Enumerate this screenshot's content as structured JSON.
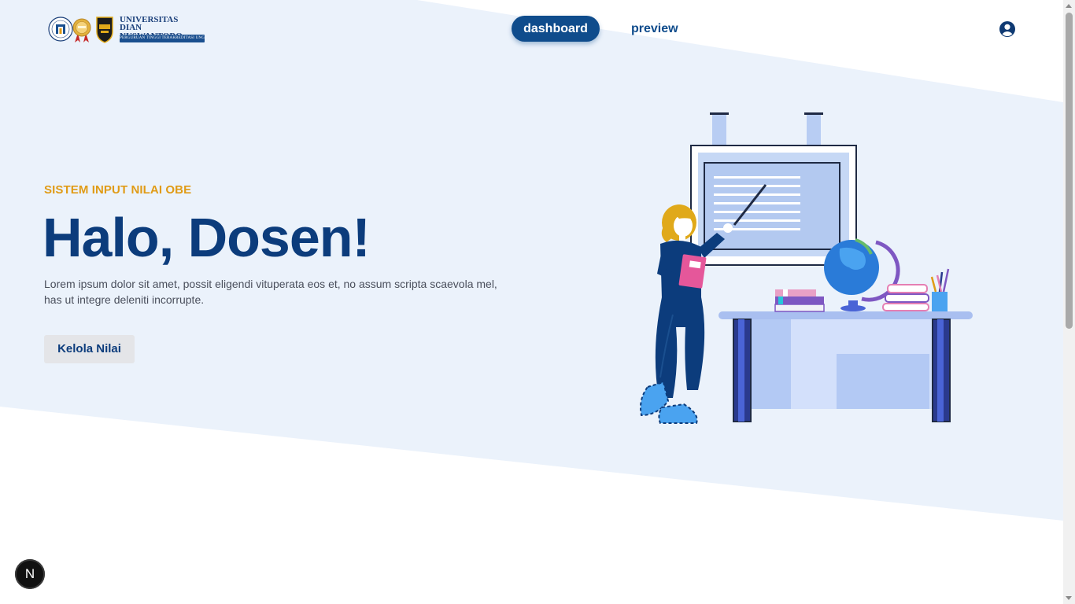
{
  "header": {
    "logo": {
      "university_line1": "UNIVERSITAS",
      "university_line2": "DIAN NUSWANTORO",
      "tagline": "PERGURUAN TINGGI TERAKREDITASI UNGGUL"
    },
    "nav": {
      "dashboard_label": "dashboard",
      "preview_label": "preview",
      "active": "dashboard"
    },
    "user_icon": "user-circle-icon"
  },
  "hero": {
    "eyebrow": "SISTEM INPUT NILAI OBE",
    "title": "Halo, Dosen!",
    "description": "Lorem ipsum dolor sit amet, possit eligendi vituperata eos et, no assum scripta scaevola mel, has ut integre deleniti incorrupte.",
    "cta_label": "Kelola Nilai"
  },
  "floating_badge": {
    "label": "N"
  },
  "colors": {
    "primary": "#0f4c8c",
    "title": "#0c3c7c",
    "accent": "#e09b16",
    "hero_bg": "#ebf2fb",
    "button_bg": "#e4e5e8"
  }
}
